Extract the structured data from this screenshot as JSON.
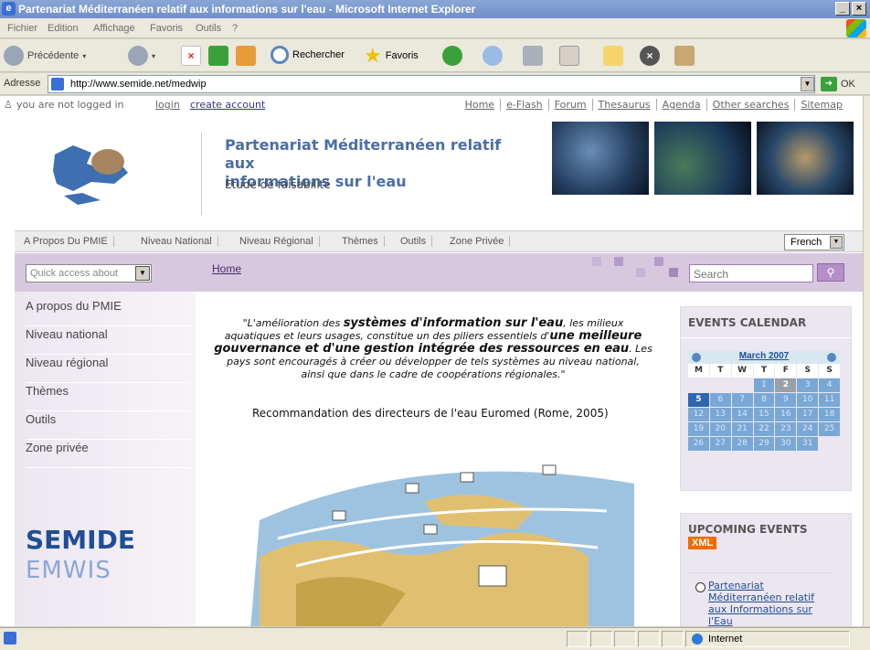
{
  "window": {
    "title": "Partenariat Méditerranéen relatif aux informations sur l'eau - Microsoft Internet Explorer",
    "controls": [
      "_",
      "×"
    ]
  },
  "menu": [
    "Fichier",
    "Edition",
    "Affichage",
    "Favoris",
    "Outils",
    "?"
  ],
  "toolbar": {
    "back_label": "Précédente",
    "search_label": "Rechercher",
    "favorites_label": "Favoris"
  },
  "address": {
    "label": "Adresse",
    "url": "http://www.semide.net/medwip",
    "go_label": "OK"
  },
  "page": {
    "login": {
      "status": "you are not logged in",
      "login_link": "login",
      "create_link": "create account"
    },
    "topnav": [
      "Home",
      "e-Flash",
      "Forum",
      "Thesaurus",
      "Agenda",
      "Other searches",
      "Sitemap"
    ],
    "header": {
      "title_line1": "Partenariat Méditerranéen relatif aux",
      "title_line2": "informations sur l'eau",
      "subtitle": "Etude de faisabilité"
    },
    "secnav": [
      "A Propos Du PMIE",
      "Niveau National",
      "Niveau Régional",
      "Thèmes",
      "Outils",
      "Zone Privée"
    ],
    "language": "French",
    "quick_access": "Quick access about",
    "breadcrumb_home": "Home",
    "search_placeholder": "Search",
    "leftnav": [
      "A propos du PMIE",
      "Niveau national",
      "Niveau régional",
      "Thèmes",
      "Outils",
      "Zone privée"
    ],
    "logo_semide": "SEMIDE",
    "logo_emwis": "EMWIS",
    "quote": {
      "p1": "\"L'amélioration des ",
      "b1": "systèmes d'information sur l'eau",
      "p2": ", les milieux aquatiques et leurs usages, constitue un des piliers essentiels d'",
      "b2": "une meilleure gouvernance et d'une gestion intégrée des ressources en eau",
      "p3": ". Les pays sont encouragés à créer ou développer de tels systèmes au niveau national, ainsi que dans le cadre de coopérations régionales.\""
    },
    "attribution": "Recommandation des directeurs de l'eau Euromed (Rome, 2005)",
    "events_calendar": {
      "title": "EVENTS CALENDAR",
      "month": "March 2007",
      "dow": [
        "M",
        "T",
        "W",
        "T",
        "F",
        "S",
        "S"
      ],
      "weeks": [
        [
          "",
          "",
          "",
          "1",
          "2",
          "3",
          "4"
        ],
        [
          "5",
          "6",
          "7",
          "8",
          "9",
          "10",
          "11"
        ],
        [
          "12",
          "13",
          "14",
          "15",
          "16",
          "17",
          "18"
        ],
        [
          "19",
          "20",
          "21",
          "22",
          "23",
          "24",
          "25"
        ],
        [
          "26",
          "27",
          "28",
          "29",
          "30",
          "31",
          ""
        ]
      ],
      "today": "2",
      "selected": "5"
    },
    "upcoming": {
      "title": "UPCOMING EVENTS",
      "badge": "XML",
      "event_link": "Partenariat Méditerranéen relatif aux Informations sur l'Eau"
    }
  },
  "status": {
    "zone": "Internet"
  }
}
